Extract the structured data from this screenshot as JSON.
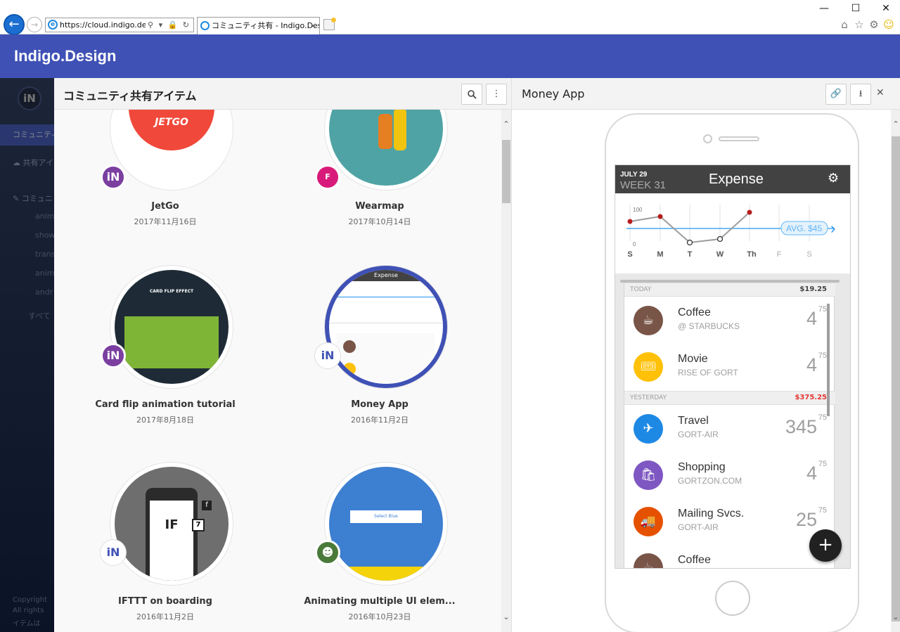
{
  "browser": {
    "url": "https://cloud.indigo.desi",
    "tab_title": "コミュニティ共有 - Indigo.Desi",
    "tab_close": "×",
    "addr_controls": "⚲ ▾ 🔒 ↻",
    "win_min": "—",
    "win_max": "☐",
    "win_close": "✕"
  },
  "app": {
    "title": "Indigo.Design",
    "accent": "#3f51b5"
  },
  "sidebar": {
    "logo": "iN",
    "active_item": "コミュニティ",
    "shared_item": "共有アイ",
    "tag_item": "コミュニ",
    "sub_items": [
      "anim",
      "show",
      "trans",
      "anim",
      "andr"
    ],
    "all_item": "すべて",
    "footer": [
      "Copyright",
      "All rights",
      "イテムは"
    ]
  },
  "community": {
    "title": "コミュニティ共有アイテム",
    "search_icon": "search-icon",
    "more_icon": "more-icon",
    "items": [
      {
        "name": "JetGo",
        "date": "2017年11月16日",
        "badge": "iN",
        "thumb_text": "JETGO"
      },
      {
        "name": "Wearmap",
        "date": "2017年10月14日",
        "badge": "F"
      },
      {
        "name": "Card flip animation tutorial",
        "date": "2017年8月18日",
        "badge": "iN",
        "thumb_text": "CARD FLIP EFFECT"
      },
      {
        "name": "Money App",
        "date": "2016年11月2日",
        "badge": "iN",
        "thumb_text": "Expense"
      },
      {
        "name": "IFTTT on boarding",
        "date": "2016年11月2日",
        "badge": "iN",
        "thumb_text": "IF"
      },
      {
        "name": "Animating multiple UI elem...",
        "date": "2016年10月23日",
        "badge": "avatar",
        "thumb_text": "Select Blue"
      }
    ]
  },
  "preview": {
    "title": "Money App",
    "expense": {
      "date": "JULY 29",
      "week": "WEEK 31",
      "title": "Expense",
      "chart": {
        "y_top": "100",
        "y_bottom": "0",
        "days": [
          "S",
          "M",
          "T",
          "W",
          "Th",
          "F",
          "S"
        ],
        "avg_label": "AVG. $45"
      },
      "sections": [
        {
          "label": "TODAY",
          "amount": "$19.25",
          "color": "#444444"
        },
        {
          "label": "YESTERDAY",
          "amount": "$375.25",
          "color": "#e53935"
        }
      ],
      "rows": [
        {
          "name": "Coffee",
          "sub": "@ STARBUCKS",
          "amt": "4",
          "cents": "75",
          "color": "#795548",
          "icon": "coffee-icon",
          "glyph": "☕"
        },
        {
          "name": "Movie",
          "sub": "RISE OF GORT",
          "amt": "4",
          "cents": "75",
          "color": "#ffc107",
          "icon": "ticket-icon",
          "glyph": "🎟"
        },
        {
          "name": "Travel",
          "sub": "GORT-AIR",
          "amt": "345",
          "cents": "75",
          "color": "#1e88e5",
          "icon": "plane-icon",
          "glyph": "✈"
        },
        {
          "name": "Shopping",
          "sub": "GORTZON.COM",
          "amt": "4",
          "cents": "75",
          "color": "#7e57c2",
          "icon": "bag-icon",
          "glyph": "🛍"
        },
        {
          "name": "Mailing Svcs.",
          "sub": "GORT-AIR",
          "amt": "25",
          "cents": "75",
          "color": "#e65100",
          "icon": "truck-icon",
          "glyph": "🚚"
        },
        {
          "name": "Coffee",
          "sub": "",
          "amt": "",
          "cents": "",
          "color": "#795548",
          "icon": "coffee-icon",
          "glyph": "☕"
        }
      ],
      "fab": "+"
    }
  }
}
